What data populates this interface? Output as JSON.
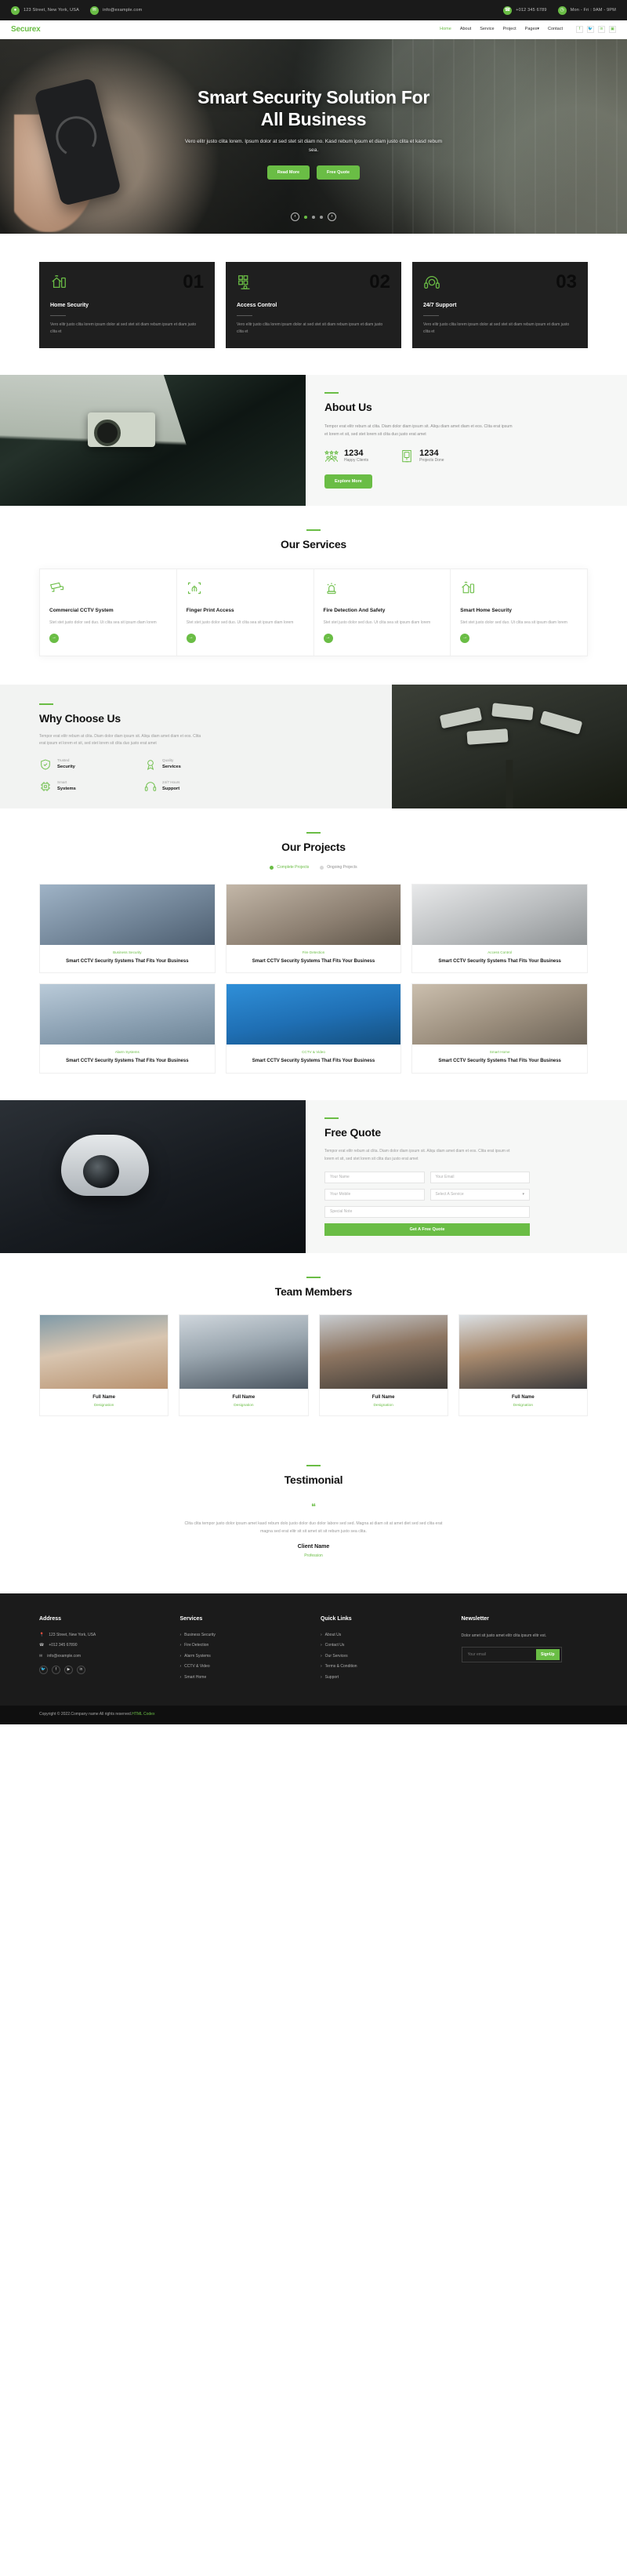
{
  "topbar": {
    "address": "123 Street, New York, USA",
    "email": "info@example.com",
    "phone": "+012 345 6789",
    "hours": "Mon - Fri : 9AM - 9PM",
    "icons": {
      "location": "location-pin-icon",
      "mail": "envelope-icon",
      "phone": "phone-icon",
      "clock": "clock-icon"
    }
  },
  "nav": {
    "logo": "Securex",
    "items": [
      {
        "label": "Home",
        "active": true
      },
      {
        "label": "About",
        "active": false
      },
      {
        "label": "Service",
        "active": false
      },
      {
        "label": "Project",
        "active": false
      },
      {
        "label": "Pages",
        "active": false,
        "caret": "▾"
      },
      {
        "label": "Contact",
        "active": false
      }
    ],
    "socials": [
      "f",
      "🐦",
      "in",
      "▣"
    ]
  },
  "hero": {
    "title_line1": "Smart Security Solution For",
    "title_line2": "All Business",
    "paragraph": "Vero elitr justo clita lorem. Ipsum dolor at sed stet sit diam no. Kasd rebum ipsum et diam justo clita et kasd rebum sea.",
    "btn_primary": "Read More",
    "btn_secondary": "Free Quote",
    "prev": "‹",
    "next": "›"
  },
  "features": [
    {
      "num": "01",
      "title": "Home Security",
      "text": "Vero elitr justo clita lorem ipsum dolor at sed stet sit diam rebum ipsum et diam justo clita et",
      "icon": "home-wifi-icon"
    },
    {
      "num": "02",
      "title": "Access Control",
      "text": "Vero elitr justo clita lorem ipsum dolor at sed stet sit diam rebum ipsum et diam justo clita et",
      "icon": "keypad-access-icon"
    },
    {
      "num": "03",
      "title": "24/7 Support",
      "text": "Vero elitr justo clita lorem ipsum dolor at sed stet sit diam rebum ipsum et diam justo clita et",
      "icon": "headset-support-icon"
    }
  ],
  "about": {
    "title": "About Us",
    "paragraph": "Tempor erat elitr rebum at clita. Diam dolor diam ipsum sit. Aliqu diam amet diam et eos. Clita erat ipsum et lorem et sit, sed stet lorem sit clita duo justo erat amet",
    "stats": [
      {
        "value": "1234",
        "label": "Happy Clients",
        "icon": "stars-people-icon"
      },
      {
        "value": "1234",
        "label": "Projects Done",
        "icon": "door-access-icon"
      }
    ],
    "button": "Explore More"
  },
  "services": {
    "title": "Our Services",
    "items": [
      {
        "title": "Commercial CCTV System",
        "text": "Stet stet justo dolor sed duo. Ut clita sea sit ipsum diam lorem",
        "icon": "cctv-camera-icon"
      },
      {
        "title": "Finger Print Access",
        "text": "Stet stet justo dolor sed duo. Ut clita sea sit ipsum diam lorem",
        "icon": "fingerprint-icon"
      },
      {
        "title": "Fire Detection And Safety",
        "text": "Stet stet justo dolor sed duo. Ut clita sea sit ipsum diam lorem",
        "icon": "alarm-siren-icon"
      },
      {
        "title": "Smart Home Security",
        "text": "Stet stet justo dolor sed duo. Ut clita sea sit ipsum diam lorem",
        "icon": "smart-home-icon"
      }
    ],
    "arrow": "→"
  },
  "why": {
    "title": "Why Choose Us",
    "paragraph": "Tempor erat elitr rebum at clita. Diam dolor diam ipsum sit. Aliqu diam amet diam et eos. Clita erat ipsum et lorem et sit, sed stet lorem sit clita duo justo erat amet",
    "items": [
      {
        "top": "Trusted",
        "bottom": "Security",
        "icon": "shield-check-icon"
      },
      {
        "top": "Quality",
        "bottom": "Services",
        "icon": "medal-quality-icon"
      },
      {
        "top": "Smart",
        "bottom": "Systems",
        "icon": "cpu-systems-icon"
      },
      {
        "top": "24/7 Hours",
        "bottom": "Support",
        "icon": "headset-support-icon"
      }
    ]
  },
  "projects": {
    "title": "Our Projects",
    "tabs": [
      {
        "label": "Complete Projects",
        "active": true
      },
      {
        "label": "Ongoing Projects",
        "active": false
      }
    ],
    "items": [
      {
        "category": "Business Security",
        "title": "Smart CCTV Security Systems That Fits Your Business"
      },
      {
        "category": "Fire Detection",
        "title": "Smart CCTV Security Systems That Fits Your Business"
      },
      {
        "category": "Access Control",
        "title": "Smart CCTV Security Systems That Fits Your Business"
      },
      {
        "category": "Alarm Systems",
        "title": "Smart CCTV Security Systems That Fits Your Business"
      },
      {
        "category": "CCTV & Video",
        "title": "Smart CCTV Security Systems That Fits Your Business"
      },
      {
        "category": "Smart Home",
        "title": "Smart CCTV Security Systems That Fits Your Business"
      }
    ]
  },
  "quote": {
    "title": "Free Quote",
    "paragraph": "Tempor erat elitr rebum at clita. Diam dolor diam ipsum sit. Aliqu diam amet diam et eos. Clita erat ipsum et lorem et sit, sed stet lorem sit clita duo justo erat amet",
    "fields": {
      "name_placeholder": "Your Name",
      "email_placeholder": "Your Email",
      "mobile_placeholder": "Your Mobile",
      "service_placeholder": "Select A Service",
      "special_placeholder": "Special Note"
    },
    "submit": "Get A Free Quote"
  },
  "team": {
    "title": "Team Members",
    "members": [
      {
        "name": "Full Name",
        "role": "Designation"
      },
      {
        "name": "Full Name",
        "role": "Designation"
      },
      {
        "name": "Full Name",
        "role": "Designation"
      },
      {
        "name": "Full Name",
        "role": "Designation"
      }
    ]
  },
  "testimonial": {
    "title": "Testimonial",
    "mark": "❝",
    "body": "Clita clita tempor justo dolor ipsum amet kasd rebum dolo justo dolor duo dolor labore sed sed. Magna at diam sit at amet diet sed sed clita erat magna sed erat elitr sit sit amet sit sit rebum justo sea clita.",
    "client_name": "Client Name",
    "client_role": "Profession"
  },
  "footer": {
    "address": {
      "heading": "Address",
      "rows": [
        {
          "icon": "location-pin-icon",
          "text": "123 Street, New York, USA"
        },
        {
          "icon": "phone-icon",
          "text": "+012 345 67890"
        },
        {
          "icon": "envelope-icon",
          "text": "info@example.com"
        }
      ],
      "socials": [
        "twitter-icon",
        "facebook-icon",
        "youtube-icon",
        "linkedin-icon"
      ]
    },
    "services": {
      "heading": "Services",
      "links": [
        "Business Security",
        "Fire Detection",
        "Alarm Systems",
        "CCTV & Video",
        "Smart Home"
      ]
    },
    "quick": {
      "heading": "Quick Links",
      "links": [
        "About Us",
        "Contact Us",
        "Our Services",
        "Terms & Condition",
        "Support"
      ]
    },
    "newsletter": {
      "heading": "Newsletter",
      "text": "Dolor amet sit justo amet elitr clita ipsum elitr est.",
      "placeholder": "Your email",
      "button": "SignUp"
    },
    "copyright": "Copyright © 2022.Company name All rights reserved.",
    "credit": "HTML Codex"
  },
  "colors": {
    "accent": "#6abd45",
    "dark": "#1b1b1b",
    "darker": "#0f0f0f"
  }
}
